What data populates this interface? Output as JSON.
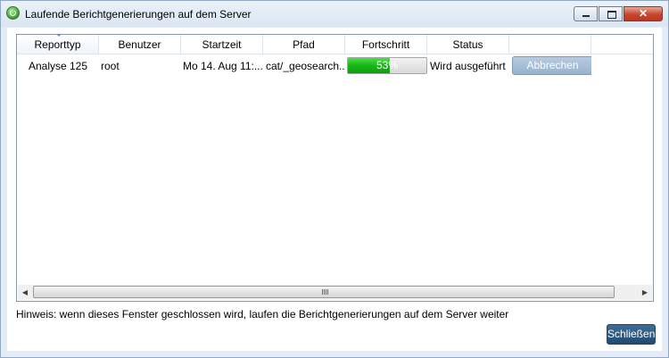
{
  "window": {
    "title": "Laufende Berichtgenerierungen auf dem Server",
    "close_glyph": "✕"
  },
  "table": {
    "columns": [
      "Reporttyp",
      "Benutzer",
      "Startzeit",
      "Pfad",
      "Fortschritt",
      "Status"
    ],
    "sorted_column": "Reporttyp",
    "rows": [
      {
        "reporttyp": "Analyse 125",
        "benutzer": "root",
        "startzeit": "Mo 14. Aug 11:...",
        "pfad": "cat/_geosearch...",
        "fortschritt_label": "53%",
        "fortschritt_value": 0.53,
        "status": "Wird ausgeführt",
        "action_label": "Abbrechen"
      }
    ]
  },
  "scrollbar": {
    "left_arrow": "◀",
    "right_arrow": "▶"
  },
  "hint": "Hinweis: wenn dieses Fenster geschlossen wird, laufen die Berichtgenerierungen auf dem Server weiter",
  "buttons": {
    "close_label": "Schließen"
  },
  "colors": {
    "progress_fill": "#17b617",
    "close_button": "#1f4a72",
    "abort_button": "#98b3cf"
  }
}
